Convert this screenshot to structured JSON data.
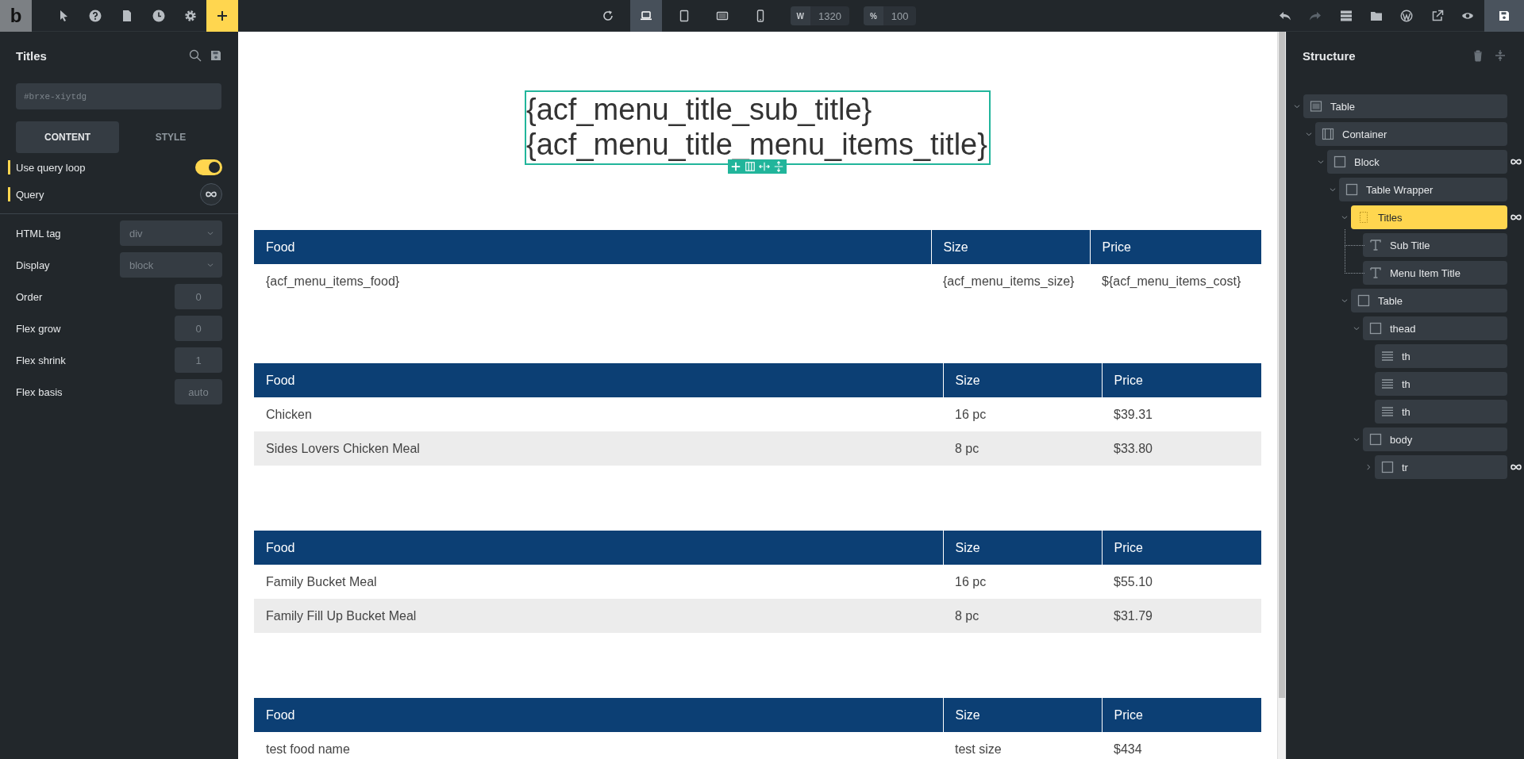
{
  "topbar": {
    "logo": "b",
    "tools": [
      {
        "kind": "pointer",
        "selected": false
      },
      {
        "kind": "help",
        "selected": false
      },
      {
        "kind": "page",
        "selected": false
      },
      {
        "kind": "history",
        "selected": false
      },
      {
        "kind": "settings",
        "selected": false
      },
      {
        "kind": "add",
        "selected": true
      }
    ],
    "devices": [
      {
        "kind": "refresh",
        "selected": false
      },
      {
        "kind": "laptop",
        "selected": true
      },
      {
        "kind": "tablet",
        "selected": false
      },
      {
        "kind": "tablet-landscape",
        "selected": false
      },
      {
        "kind": "phone",
        "selected": false
      }
    ],
    "width_field": {
      "label": "W",
      "value": "1320"
    },
    "zoom_field": {
      "label": "%",
      "value": "100"
    },
    "actions": [
      {
        "kind": "undo",
        "disabled": false
      },
      {
        "kind": "redo",
        "disabled": true
      },
      {
        "kind": "stack",
        "disabled": false
      },
      {
        "kind": "folder",
        "disabled": false
      },
      {
        "kind": "w-circle",
        "disabled": false
      },
      {
        "kind": "external",
        "disabled": false
      },
      {
        "kind": "preview",
        "disabled": false
      },
      {
        "kind": "save",
        "disabled": false
      }
    ]
  },
  "left_panel": {
    "title": "Titles",
    "id_field": {
      "placeholder": "#brxe-xiytdg"
    },
    "tabs": [
      {
        "label": "CONTENT",
        "selected": true
      },
      {
        "label": "STYLE",
        "selected": false
      }
    ],
    "settings": [
      {
        "kind": "toggle",
        "label": "Use query loop",
        "modified": true,
        "on": true
      },
      {
        "kind": "query",
        "label": "Query",
        "modified": true
      }
    ],
    "properties": [
      {
        "kind": "select",
        "label": "HTML tag",
        "value": "div"
      },
      {
        "kind": "select",
        "label": "Display",
        "value": "block"
      },
      {
        "kind": "number",
        "label": "Order",
        "value": "0"
      },
      {
        "kind": "number",
        "label": "Flex grow",
        "value": "0"
      },
      {
        "kind": "number",
        "label": "Flex shrink",
        "value": "1"
      },
      {
        "kind": "number",
        "label": "Flex basis",
        "value": "auto"
      }
    ]
  },
  "canvas": {
    "heading_lines": [
      "{acf_menu_title_sub_title}",
      "{acf_menu_title_menu_items_title}"
    ],
    "tables": [
      {
        "columns": [
          "Food",
          "Size",
          "Price"
        ],
        "rows": [
          [
            "{acf_menu_items_food}",
            "{acf_menu_items_size}",
            "${acf_menu_items_cost}"
          ]
        ]
      },
      {
        "columns": [
          "Food",
          "Size",
          "Price"
        ],
        "rows": [
          [
            "Chicken",
            "16 pc",
            "$39.31"
          ],
          [
            "Sides Lovers Chicken Meal",
            "8 pc",
            "$33.80"
          ]
        ]
      },
      {
        "columns": [
          "Food",
          "Size",
          "Price"
        ],
        "rows": [
          [
            "Family Bucket Meal",
            "16 pc",
            "$55.10"
          ],
          [
            "Family Fill Up Bucket Meal",
            "8 pc",
            "$31.79"
          ]
        ]
      },
      {
        "columns": [
          "Food",
          "Size",
          "Price"
        ],
        "rows": [
          [
            "test food name",
            "test size",
            "$434"
          ]
        ]
      }
    ]
  },
  "structure": {
    "title": "Structure",
    "tree": [
      {
        "label": "Table",
        "kind": "section",
        "selected": false,
        "expanded": true,
        "query_loop": false,
        "children": [
          {
            "label": "Container",
            "kind": "container",
            "selected": false,
            "expanded": true,
            "query_loop": false,
            "children": [
              {
                "label": "Block",
                "kind": "block",
                "selected": false,
                "expanded": true,
                "query_loop": true,
                "children": [
                  {
                    "label": "Table Wrapper",
                    "kind": "block",
                    "selected": false,
                    "expanded": true,
                    "query_loop": false,
                    "children": [
                      {
                        "label": "Titles",
                        "kind": "div",
                        "selected": true,
                        "expanded": true,
                        "query_loop": true,
                        "children": [
                          {
                            "label": "Sub Title",
                            "kind": "text",
                            "selected": false,
                            "query_loop": false
                          },
                          {
                            "label": "Menu Item Title",
                            "kind": "text",
                            "selected": false,
                            "query_loop": false
                          }
                        ]
                      },
                      {
                        "label": "Table",
                        "kind": "block",
                        "selected": false,
                        "expanded": true,
                        "query_loop": false,
                        "children": [
                          {
                            "label": "thead",
                            "kind": "block",
                            "selected": false,
                            "expanded": true,
                            "query_loop": false,
                            "children": [
                              {
                                "label": "th",
                                "kind": "cell",
                                "selected": false,
                                "query_loop": false
                              },
                              {
                                "label": "th",
                                "kind": "cell",
                                "selected": false,
                                "query_loop": false
                              },
                              {
                                "label": "th",
                                "kind": "cell",
                                "selected": false,
                                "query_loop": false
                              }
                            ]
                          },
                          {
                            "label": "body",
                            "kind": "block",
                            "selected": false,
                            "expanded": true,
                            "query_loop": false,
                            "children": [
                              {
                                "label": "tr",
                                "kind": "block",
                                "selected": false,
                                "expanded": false,
                                "query_loop": true
                              }
                            ]
                          }
                        ]
                      }
                    ]
                  }
                ]
              }
            ]
          }
        ]
      }
    ]
  }
}
